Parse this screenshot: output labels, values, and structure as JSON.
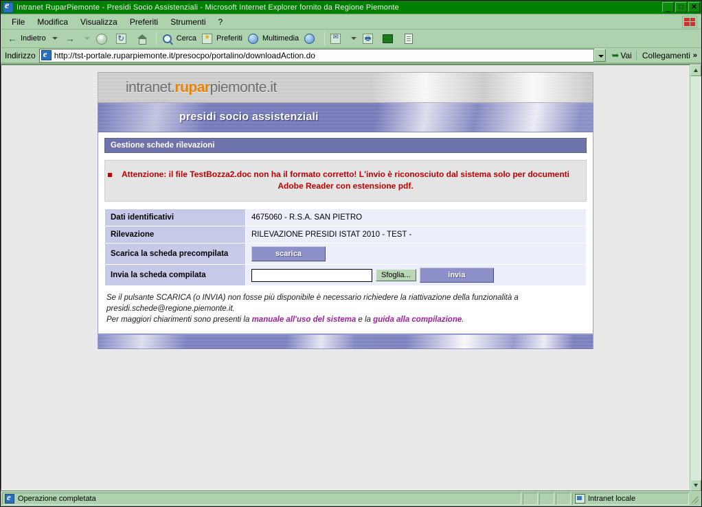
{
  "window": {
    "title": "Intranet RuparPiemonte - Presidi Socio Assistenziali - Microsoft Internet Explorer fornito da Regione Piemonte",
    "app_icon": "ie-logo-icon",
    "minimize_glyph": "_",
    "maximize_glyph": "□",
    "close_glyph": "✕"
  },
  "menubar": {
    "items": [
      {
        "label": "File",
        "accel": "F"
      },
      {
        "label": "Modifica",
        "accel": "M"
      },
      {
        "label": "Visualizza",
        "accel": "V"
      },
      {
        "label": "Preferiti",
        "accel": "P"
      },
      {
        "label": "Strumenti",
        "accel": "S"
      },
      {
        "label": "?",
        "accel": "?"
      }
    ],
    "brand_icon": "windows-flag-icon"
  },
  "toolbar": {
    "back_label": "Indietro",
    "back_icon": "arrow-left-icon",
    "forward_icon": "arrow-right-icon",
    "stop_icon": "stop-icon",
    "refresh_icon": "refresh-icon",
    "home_icon": "home-icon",
    "search_label": "Cerca",
    "search_icon": "search-icon",
    "favorites_label": "Preferiti",
    "favorites_icon": "star-icon",
    "media_label": "Multimedia",
    "media_icon": "media-icon",
    "history_icon": "history-globe-icon",
    "mail_icon": "mail-icon",
    "print_icon": "printer-icon",
    "messenger_icon": "messenger-icon",
    "edit_icon": "edit-document-icon"
  },
  "addressbar": {
    "label": "Indirizzo",
    "url": "http://tst-portale.ruparpiemonte.it/presocpo/portalino/downloadAction.do",
    "page_icon": "ie-page-icon",
    "dropdown_icon": "chevron-down-icon",
    "go_label": "Vai",
    "go_icon": "go-arrow-icon",
    "links_label": "Collegamenti",
    "links_chevrons": "»"
  },
  "page": {
    "logo": {
      "prefix": "intranet.",
      "brand": "rupar",
      "suffix": "piemonte.it"
    },
    "banner_title": "presidi socio assistenziali",
    "section_title": "Gestione schede rilevazioni",
    "alert": {
      "text": "Attenzione: il file TestBozza2.doc non ha il formato corretto! L'invio è riconosciuto dal sistema solo per documenti Adobe Reader con estensione pdf.",
      "bullet_icon": "square-bullet-icon",
      "color": "#c00000"
    },
    "rows": [
      {
        "label": "Dati identificativi",
        "value": "4675060 - R.S.A. SAN PIETRO",
        "type": "text"
      },
      {
        "label": "Rilevazione",
        "value": "RILEVAZIONE PRESIDI ISTAT 2010 - TEST -",
        "type": "text"
      },
      {
        "label": "Scarica la scheda precompilata",
        "value": "",
        "type": "download"
      },
      {
        "label": "Invia la scheda compilata",
        "value": "",
        "type": "upload"
      }
    ],
    "download_button": "scarica",
    "upload": {
      "file_value": "",
      "file_placeholder": "",
      "browse_label": "Sfoglia...",
      "submit_label": "invia"
    },
    "notes": {
      "line1": "Se il pulsante SCARICA (o INVIA) non fosse più disponibile è necessario richiedere la riattivazione della funzionalità a",
      "line2": "presidi.schede@regione.piemonte.it.",
      "line3_pre": "Per maggiori chiarimenti sono presenti la ",
      "link1": "manuale all'uso del sistema",
      "line3_mid": " e la ",
      "link2": "guida alla compilazione",
      "line3_post": "."
    },
    "colors": {
      "banner": "#5b5fa8",
      "section_bar": "#6f73ab",
      "label_cell": "#c7c9e8",
      "value_cell": "#eceefa",
      "button": "#8c8fc8",
      "link": "#a020a0",
      "brand_orange": "#e8820c"
    }
  },
  "statusbar": {
    "message": "Operazione completata",
    "message_icon": "ie-status-icon",
    "zone": "Intranet locale",
    "zone_icon": "intranet-zone-icon"
  },
  "scrollbar": {
    "up_icon": "scroll-up-icon",
    "down_icon": "scroll-down-icon"
  }
}
